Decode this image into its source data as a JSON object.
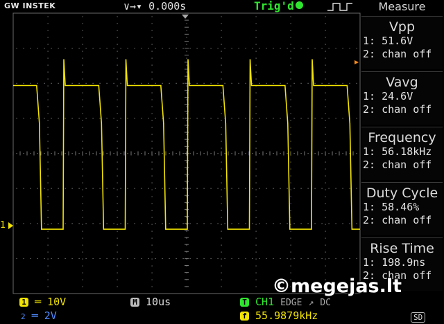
{
  "header": {
    "brand": "GW INSTEK",
    "horizontal_position": "∨→▾ 0.000s",
    "trigger_status": "Trig'd"
  },
  "measure": {
    "title": "Measure",
    "items": [
      {
        "name": "Vpp",
        "ch1": "1: 51.6V",
        "ch2": "2: chan off"
      },
      {
        "name": "Vavg",
        "ch1": "1: 24.6V",
        "ch2": "2: chan off"
      },
      {
        "name": "Frequency",
        "ch1": "1: 56.18kHz",
        "ch2": "2: chan off"
      },
      {
        "name": "Duty Cycle",
        "ch1": "1: 58.46%",
        "ch2": "2: chan off"
      },
      {
        "name": "Rise Time",
        "ch1": "1: 198.9ns",
        "ch2": "2: chan off"
      }
    ]
  },
  "footer": {
    "ch1_badge": "1",
    "ch1_scale": "═ 10V",
    "ch2_badge": "2",
    "ch2_scale": "═ 2V",
    "timebase_badge": "M",
    "timebase": "10us",
    "trigger_badge": "T",
    "trigger_source": "CH1",
    "trigger_type": "EDGE",
    "trigger_slope": "↗",
    "trigger_level": "DC",
    "freq_badge": "f",
    "frequency": "55.9879kHz",
    "storage": "SD"
  },
  "marker": {
    "channel1": "1"
  },
  "watermark": "©megejas.lt",
  "colors": {
    "ch1": "#f2e400",
    "ch2": "#4f8cff",
    "trigger": "#2ee62e",
    "grid": "#6a6a6a"
  },
  "waveform": {
    "high_level_div": 4.0,
    "low_level_div": -0.1,
    "period_div": 1.79,
    "duty_cycle_percent": 58.46
  }
}
